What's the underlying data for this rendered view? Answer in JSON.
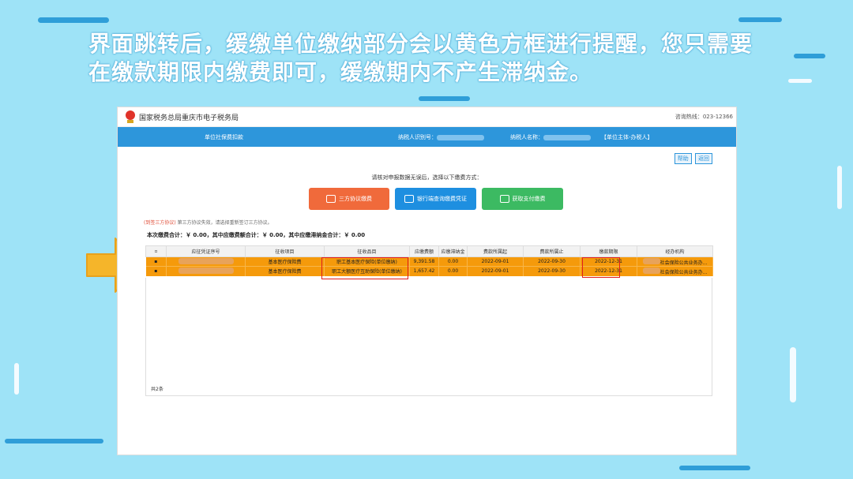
{
  "caption": {
    "line1": "界面跳转后，缓缴单位缴纳部分会以黄色方框进行提醒，您只需要",
    "line2": "在缴款期限内缴费即可，缓缴期内不产生滞纳金。"
  },
  "site": {
    "title": "国家税务总局重庆市电子税务局",
    "hotline": "咨询热线：023-12366"
  },
  "navbar": {
    "section": "单位社保费扣款",
    "taxpayer_id_label": "纳税人识别号：",
    "taxpayer_name_label": "纳税人名称：",
    "role": "【单位主体-办税人】"
  },
  "utility": {
    "help": "帮助",
    "back": "返回"
  },
  "prompt": "请核对申报数据无误后，选择以下缴费方式：",
  "payment_methods": [
    {
      "label": "三方协议缴费",
      "color": "#f06a3b"
    },
    {
      "label": "银行端查询缴费凭证",
      "color": "#1e8fe0"
    },
    {
      "label": "获取支付缴费",
      "color": "#3cba62"
    }
  ],
  "note": {
    "link": "(到签三方协议)",
    "text": " 第三方协议失效，请选择重新签订三方协议。"
  },
  "totals": "本次缴费合计：￥ 0.00，其中应缴费额合计：￥ 0.00，其中应缴滞纳金合计：￥ 0.00",
  "table": {
    "headers": [
      "",
      "应征凭证序号",
      "征收项目",
      "征收品目",
      "应缴费额",
      "应缴滞纳金",
      "费款所属起",
      "费款所属止",
      "缴款期限",
      "经办机构"
    ],
    "rows": [
      {
        "project": "基本医疗保险费",
        "item": "职工基本医疗保险(单位缴纳)",
        "amount": "9,391.58",
        "late_fee": "0.00",
        "start": "2022-09-01",
        "end": "2022-09-30",
        "deadline": "2022-12-31",
        "agency": "社会保险公共业务办..."
      },
      {
        "project": "基本医疗保险费",
        "item": "职工大额医疗互助保险(单位缴纳)",
        "amount": "1,657.42",
        "late_fee": "0.00",
        "start": "2022-09-01",
        "end": "2022-09-30",
        "deadline": "2022-12-31",
        "agency": "社会保险公共业务办..."
      }
    ],
    "count": "共2条"
  }
}
